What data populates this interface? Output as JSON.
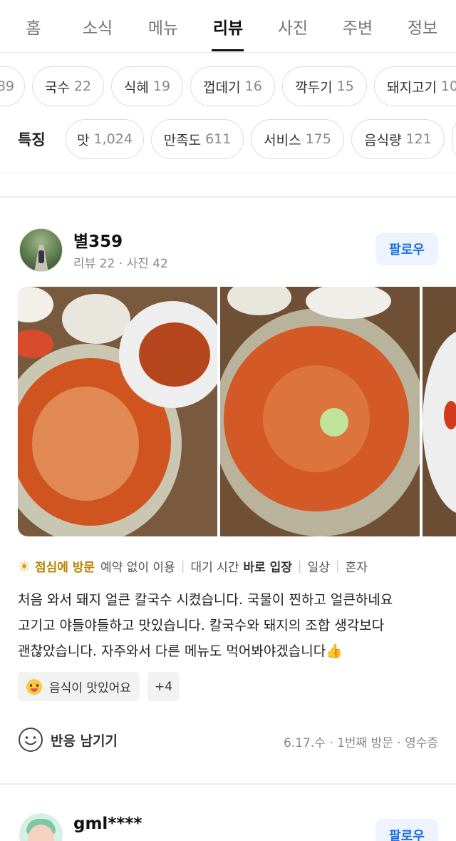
{
  "tabs": [
    "홈",
    "소식",
    "메뉴",
    "리뷰",
    "사진",
    "주변",
    "정보"
  ],
  "active_tab": "리뷰",
  "keyword_chips": [
    {
      "label": "",
      "count": "89"
    },
    {
      "label": "국수",
      "count": "22"
    },
    {
      "label": "식혜",
      "count": "19"
    },
    {
      "label": "껍데기",
      "count": "16"
    },
    {
      "label": "깍두기",
      "count": "15"
    },
    {
      "label": "돼지고기",
      "count": "10"
    }
  ],
  "features": {
    "label": "특징",
    "chips": [
      {
        "label": "맛",
        "count": "1,024"
      },
      {
        "label": "만족도",
        "count": "611"
      },
      {
        "label": "서비스",
        "count": "175"
      },
      {
        "label": "음식량",
        "count": "121"
      }
    ]
  },
  "review": {
    "user_name": "별359",
    "user_meta": "리뷰 22 · 사진 42",
    "follow_label": "팔로우",
    "visit": {
      "time": "점심에 방문",
      "reservation": "예약 없이 이용",
      "wait_prefix": "대기 시간",
      "wait_value": "바로 입장",
      "purpose": "일상",
      "companion": "혼자"
    },
    "text_lines": [
      "처음 와서 돼지 얼큰 칼국수 시켰습니다. 국물이 찐하고 얼큰하네요",
      "고기고 야들야들하고 맛있습니다. 칼국수와 돼지의 조합 생각보다",
      "괜찮았습니다. 자주와서 다른 메뉴도 먹어봐야겠습니다👍"
    ],
    "tag": "음식이 맛있어요",
    "more_tags": "+4",
    "react_label": "반응 남기기",
    "footer": "6.17.수 · 1번째 방문 · 영수증"
  },
  "next_review": {
    "user_name": "gml****",
    "follow_label": "팔로우"
  },
  "colors": {
    "accent_blue": "#1a6ee6",
    "visit_yellow": "#b98300"
  },
  "icons": [
    "sun-icon",
    "smile-outline-icon",
    "yum-emoji-icon"
  ]
}
